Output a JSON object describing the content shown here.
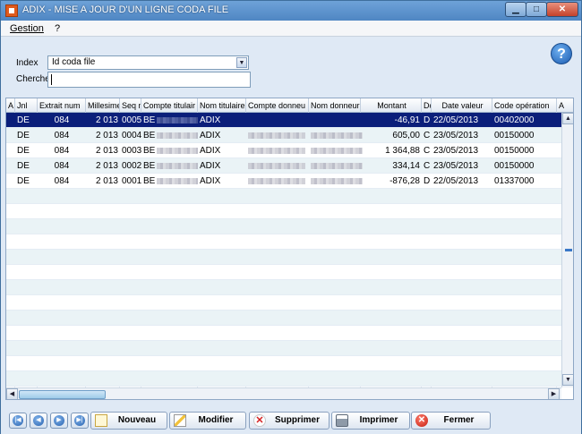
{
  "window": {
    "title": "ADIX - MISE A JOUR D'UN LIGNE CODA FILE",
    "minimize_label": "▁",
    "maximize_label": "□",
    "close_label": "✕"
  },
  "menu": [
    {
      "label": "Gestion"
    },
    {
      "label": "?"
    }
  ],
  "filters": {
    "index_label": "Index",
    "index_value": "Id coda file",
    "search_label": "Cherche",
    "search_value": ""
  },
  "help_icon_glyph": "?",
  "table": {
    "columns": [
      "A",
      "Jnl",
      "Extrait num",
      "Millesime",
      "Seq n",
      "Compte titulair",
      "Nom titulaire",
      "Compte donneu",
      "Nom donneur",
      "Montant",
      "Dc",
      "Date valeur",
      "Code opération",
      "A"
    ],
    "rows": [
      {
        "jnl": "DE",
        "extrait": "084",
        "millesime": "2 013",
        "seq": "0005",
        "compte": "BE",
        "nom_titulaire": "ADIX",
        "montant": "-46,91",
        "dc": "D",
        "date": "22/05/2013",
        "code": "00402000",
        "selected": true
      },
      {
        "jnl": "DE",
        "extrait": "084",
        "millesime": "2 013",
        "seq": "0004",
        "compte": "BE",
        "nom_titulaire": "ADIX",
        "montant": "605,00",
        "dc": "C",
        "date": "23/05/2013",
        "code": "00150000",
        "selected": false
      },
      {
        "jnl": "DE",
        "extrait": "084",
        "millesime": "2 013",
        "seq": "0003",
        "compte": "BE",
        "nom_titulaire": "ADIX",
        "montant": "1 364,88",
        "dc": "C",
        "date": "23/05/2013",
        "code": "00150000",
        "selected": false
      },
      {
        "jnl": "DE",
        "extrait": "084",
        "millesime": "2 013",
        "seq": "0002",
        "compte": "BE",
        "nom_titulaire": "ADIX",
        "montant": "334,14",
        "dc": "C",
        "date": "23/05/2013",
        "code": "00150000",
        "selected": false
      },
      {
        "jnl": "DE",
        "extrait": "084",
        "millesime": "2 013",
        "seq": "0001",
        "compte": "BE",
        "nom_titulaire": "ADIX",
        "montant": "-876,28",
        "dc": "D",
        "date": "22/05/2013",
        "code": "01337000",
        "selected": false
      }
    ],
    "empty_rows": 13
  },
  "scrollbars": {
    "up": "▲",
    "down": "▼",
    "left": "◀",
    "right": "▶"
  },
  "nav": {
    "first": "|◀",
    "prev": "◀",
    "next": "▶",
    "last": "▶|"
  },
  "actions": {
    "new_label": "Nouveau",
    "edit_label": "Modifier",
    "delete_label": "Supprimer",
    "print_label": "Imprimer",
    "close_label": "Fermer",
    "delete_icon": "✕",
    "close_icon": "✕"
  }
}
